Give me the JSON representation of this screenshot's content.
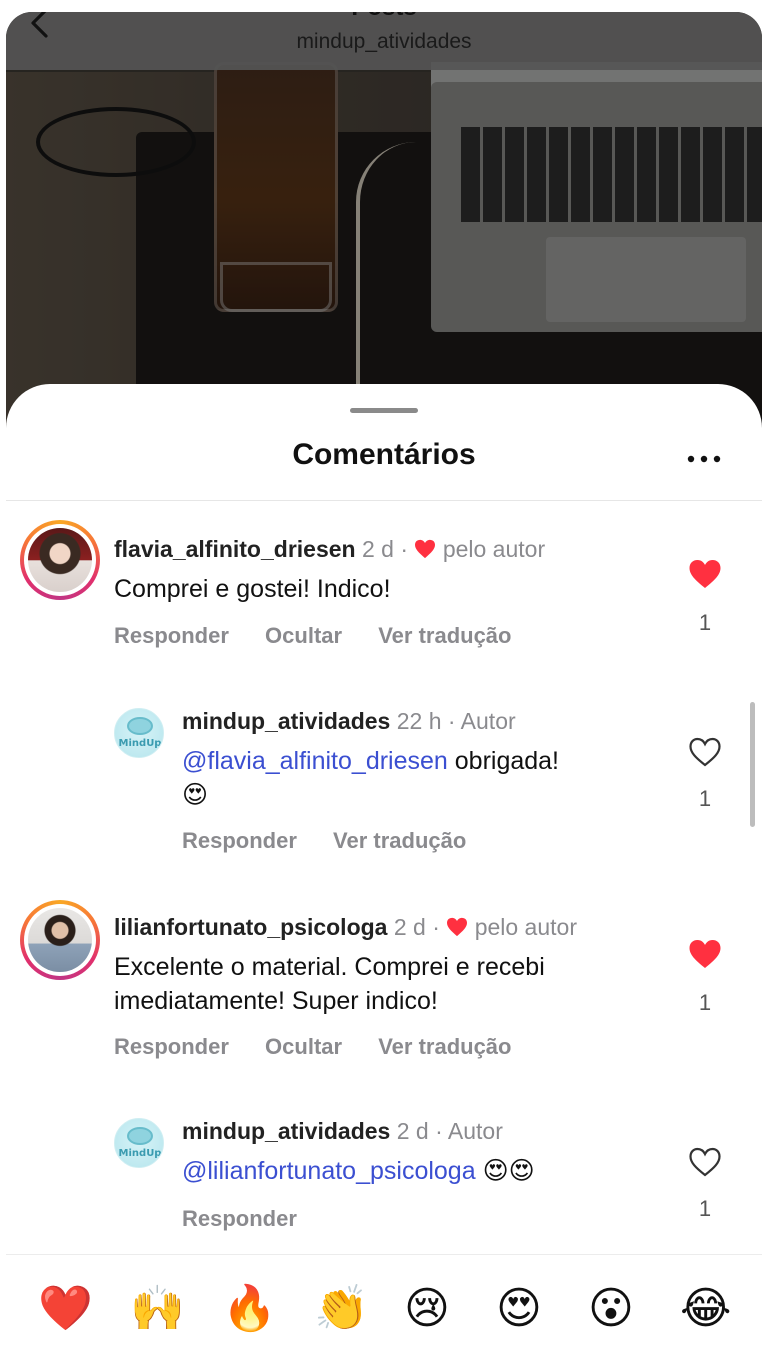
{
  "header": {
    "title": "Posts",
    "subtitle": "mindup_atividades"
  },
  "sheet": {
    "title": "Comentários"
  },
  "comments": [
    {
      "username": "flavia_alfinito_driesen",
      "time": "2 d",
      "separator": "·",
      "badge": "pelo autor",
      "text": "Comprei e gostei! Indico!",
      "actions": [
        "Responder",
        "Ocultar",
        "Ver tradução"
      ],
      "likes": "1",
      "liked": true
    },
    {
      "username": "mindup_atividades",
      "time": "22 h",
      "separator": "·",
      "badge": "Autor",
      "mention": "@flavia_alfinito_driesen",
      "text": " obrigada!",
      "emoji": "😍",
      "actions": [
        "Responder",
        "Ver tradução"
      ],
      "likes": "1",
      "liked": false,
      "avatar_text": "MindUp"
    },
    {
      "username": "lilianfortunato_psicologa",
      "time": "2 d",
      "separator": "·",
      "badge": "pelo autor",
      "text": "Excelente o material. Comprei e recebi imediatamente! Super indico!",
      "actions": [
        "Responder",
        "Ocultar",
        "Ver tradução"
      ],
      "likes": "1",
      "liked": true
    },
    {
      "username": "mindup_atividades",
      "time": "2 d",
      "separator": "·",
      "badge": "Autor",
      "mention": "@lilianfortunato_psicologa",
      "emoji": "😍😍",
      "actions": [
        "Responder"
      ],
      "likes": "1",
      "liked": false,
      "avatar_text": "MindUp"
    }
  ],
  "quick_reactions": [
    "❤️",
    "🙌",
    "🔥",
    "👏",
    "😢",
    "😍",
    "😮",
    "😂"
  ],
  "colors": {
    "like_red": "#ff3040",
    "mention_blue": "#3b4fd1",
    "meta_gray": "#8a8a8e"
  }
}
